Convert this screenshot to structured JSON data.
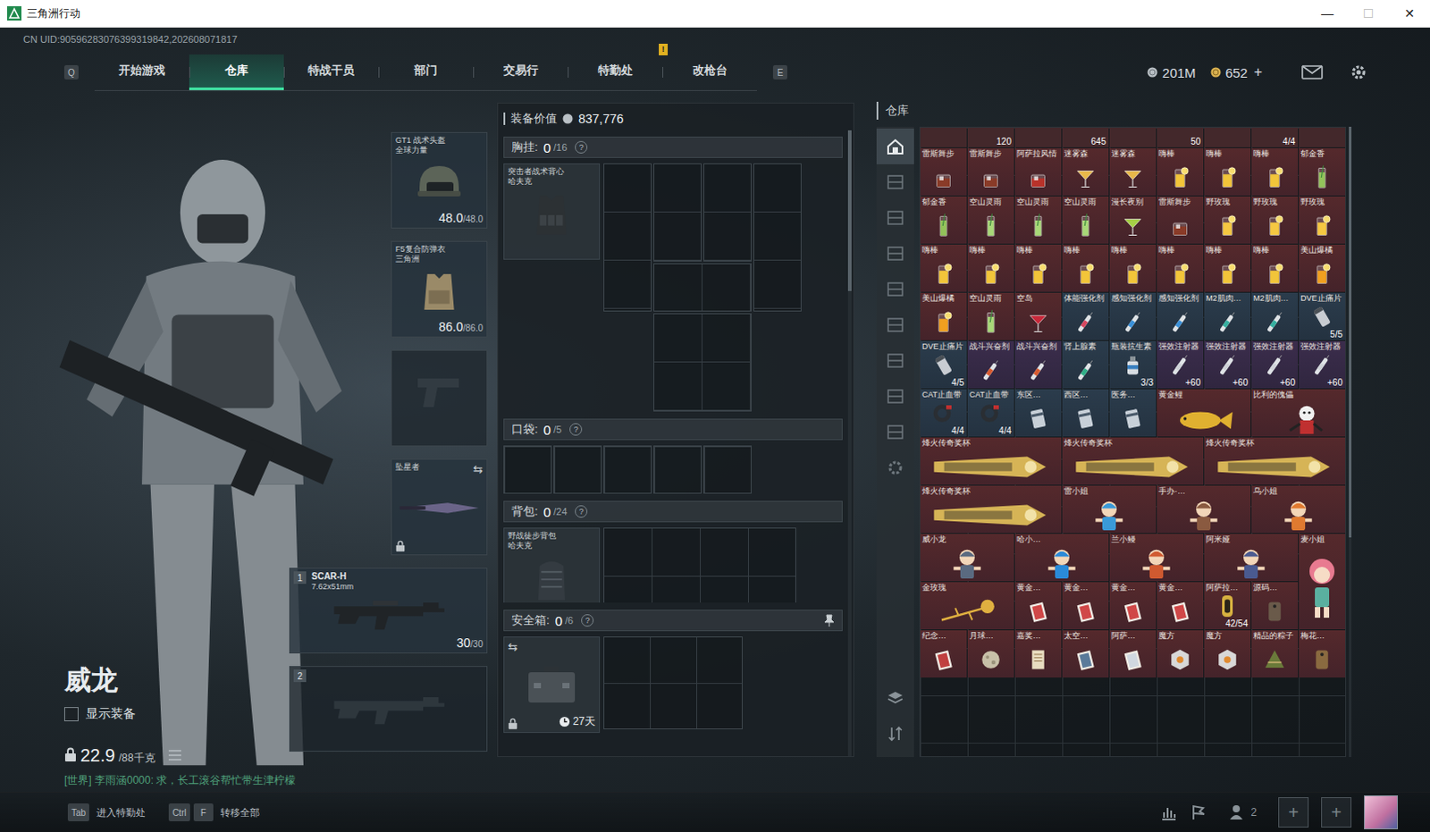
{
  "window": {
    "title": "三角洲行动",
    "controls": [
      {
        "label": "—",
        "kind": "minimize",
        "disabled": false
      },
      {
        "label": "☐",
        "kind": "maximize",
        "disabled": true
      },
      {
        "label": "✕",
        "kind": "close",
        "disabled": false
      }
    ]
  },
  "uid": "CN UID:90596283076399319842,202608071817",
  "nav": {
    "prev_key": "Q",
    "next_key": "E",
    "tabs": [
      {
        "label": "开始游戏",
        "selected": false,
        "notice": ""
      },
      {
        "label": "仓库",
        "selected": true,
        "notice": ""
      },
      {
        "label": "特战干员",
        "selected": false,
        "notice": ""
      },
      {
        "label": "部门",
        "selected": false,
        "notice": ""
      },
      {
        "label": "交易行",
        "selected": false,
        "notice": ""
      },
      {
        "label": "特勤处",
        "selected": false,
        "notice": "!"
      },
      {
        "label": "改枪台",
        "selected": false,
        "notice": ""
      }
    ]
  },
  "currency": [
    {
      "amount": "201M",
      "plus": ""
    },
    {
      "amount": "652",
      "plus": "+"
    }
  ],
  "operator": {
    "name": "威龙",
    "show_gear": {
      "label": "显示装备",
      "checked": false
    },
    "weight": "22.9",
    "weight_max": "/88千克",
    "locked": true
  },
  "chat": "[世界] 李雨涵0000: 求，长工滚谷帮忙带生津柠檬",
  "gear": [
    {
      "kind": "helmet",
      "name": "GT1 战术头盔",
      "sub": "全球力量",
      "durability": "48.0",
      "max": "/48.0",
      "empty": false,
      "locked": false,
      "swap": ""
    },
    {
      "kind": "armor",
      "name": "F5复合防弹衣",
      "sub": "三角洲",
      "durability": "86.0",
      "max": "/86.0",
      "empty": false,
      "locked": false,
      "swap": ""
    },
    {
      "kind": "pistol",
      "name": "",
      "sub": "",
      "durability": "",
      "max": "",
      "empty": true,
      "locked": false,
      "swap": ""
    },
    {
      "kind": "melee",
      "name": "坠星者",
      "sub": "",
      "durability": "",
      "max": "",
      "empty": false,
      "locked": true,
      "swap": "⇆"
    }
  ],
  "weapons": [
    {
      "index": "1",
      "name": "SCAR-H",
      "caliber": "7.62x51mm",
      "ammo": "30",
      "ammo_max": "/30",
      "empty": false
    },
    {
      "index": "2",
      "name": "",
      "caliber": "",
      "ammo": "",
      "ammo_max": "",
      "empty": true
    }
  ],
  "loadout": {
    "label": "装备价值",
    "value": "837,776",
    "sections": [
      {
        "kind": "rig",
        "title": "胸挂",
        "count": "0",
        "capacity": "/16",
        "help": "?",
        "item": {
          "name": "突击者战术背心",
          "sub": "哈夫克"
        },
        "days": "",
        "locked": false,
        "swap": "",
        "pinned": false
      },
      {
        "kind": "pockets",
        "title": "口袋",
        "count": "0",
        "capacity": "/5",
        "help": "?",
        "item": null,
        "days": "",
        "locked": false,
        "swap": "",
        "pinned": false
      },
      {
        "kind": "backpack",
        "title": "背包",
        "count": "0",
        "capacity": "/24",
        "help": "?",
        "item": {
          "name": "野战徒步背包",
          "sub": "哈夫克"
        },
        "days": "",
        "locked": false,
        "swap": "",
        "pinned": false
      },
      {
        "kind": "case",
        "title": "安全箱",
        "count": "0",
        "capacity": "/6",
        "help": "?",
        "item": null,
        "days": "27天",
        "locked": true,
        "swap": "⇆",
        "pinned": true
      }
    ]
  },
  "stash": {
    "title": "仓库",
    "side_tabs": [
      {
        "kind": "home",
        "selected": true
      },
      {
        "kind": "shelf",
        "selected": false
      },
      {
        "kind": "shelf",
        "selected": false
      },
      {
        "kind": "shelf",
        "selected": false
      },
      {
        "kind": "shelf",
        "selected": false
      },
      {
        "kind": "shelf",
        "selected": false
      },
      {
        "kind": "shelf",
        "selected": false
      },
      {
        "kind": "shelf",
        "selected": false
      },
      {
        "kind": "shelf",
        "selected": false
      },
      {
        "kind": "gear",
        "selected": false
      }
    ],
    "tools": [
      {
        "kind": "layers"
      },
      {
        "kind": "sort"
      }
    ],
    "top_row": [
      {
        "count": ""
      },
      {
        "count": "120"
      },
      {
        "count": ""
      },
      {
        "count": "645"
      },
      {
        "count": ""
      },
      {
        "count": "50"
      },
      {
        "count": ""
      },
      {
        "count": "4/4"
      },
      {
        "count": ""
      }
    ],
    "items": [
      {
        "name": "雷斯舞步",
        "kind": "tumbler",
        "color": "#8a3b28",
        "rarity": "red",
        "count": ""
      },
      {
        "name": "雷斯舞步",
        "kind": "tumbler",
        "color": "#8a3b28",
        "rarity": "red",
        "count": ""
      },
      {
        "name": "阿萨拉风情",
        "kind": "tumbler",
        "color": "#b8322a",
        "rarity": "red",
        "count": ""
      },
      {
        "name": "迷雾森",
        "kind": "coupe",
        "color": "#e8b84a",
        "rarity": "red",
        "count": ""
      },
      {
        "name": "迷雾森",
        "kind": "coupe",
        "color": "#e8b84a",
        "rarity": "red",
        "count": ""
      },
      {
        "name": "嗨棒",
        "kind": "highball",
        "color": "#f2c53a",
        "rarity": "red",
        "count": ""
      },
      {
        "name": "嗨棒",
        "kind": "highball",
        "color": "#f2c53a",
        "rarity": "red",
        "count": ""
      },
      {
        "name": "嗨棒",
        "kind": "highball",
        "color": "#f2c53a",
        "rarity": "red",
        "count": ""
      },
      {
        "name": "郁金香",
        "kind": "tall",
        "color": "#93c25a",
        "rarity": "red",
        "count": ""
      },
      {
        "name": "郁金香",
        "kind": "tall",
        "color": "#93c25a",
        "rarity": "red",
        "count": ""
      },
      {
        "name": "空山灵雨",
        "kind": "tall",
        "color": "#a8d878",
        "rarity": "red",
        "count": ""
      },
      {
        "name": "空山灵雨",
        "kind": "tall",
        "color": "#a8d878",
        "rarity": "red",
        "count": ""
      },
      {
        "name": "空山灵雨",
        "kind": "tall",
        "color": "#a8d878",
        "rarity": "red",
        "count": ""
      },
      {
        "name": "漫长夜别",
        "kind": "coupe",
        "color": "#a6d046",
        "rarity": "red",
        "count": ""
      },
      {
        "name": "雷斯舞步",
        "kind": "tumbler",
        "color": "#8a3b28",
        "rarity": "red",
        "count": ""
      },
      {
        "name": "野玫瑰",
        "kind": "highball",
        "color": "#f5c842",
        "rarity": "red",
        "count": ""
      },
      {
        "name": "野玫瑰",
        "kind": "highball",
        "color": "#f5c842",
        "rarity": "red",
        "count": ""
      },
      {
        "name": "野玫瑰",
        "kind": "highball",
        "color": "#f5c842",
        "rarity": "red",
        "count": ""
      },
      {
        "name": "嗨棒",
        "kind": "highball",
        "color": "#f2c53a",
        "rarity": "red",
        "count": ""
      },
      {
        "name": "嗨棒",
        "kind": "highball",
        "color": "#f2c53a",
        "rarity": "red",
        "count": ""
      },
      {
        "name": "嗨棒",
        "kind": "highball",
        "color": "#f2c53a",
        "rarity": "red",
        "count": ""
      },
      {
        "name": "嗨棒",
        "kind": "highball",
        "color": "#f2c53a",
        "rarity": "red",
        "count": ""
      },
      {
        "name": "嗨棒",
        "kind": "highball",
        "color": "#f2c53a",
        "rarity": "red",
        "count": ""
      },
      {
        "name": "嗨棒",
        "kind": "highball",
        "color": "#f2c53a",
        "rarity": "red",
        "count": ""
      },
      {
        "name": "嗨棒",
        "kind": "highball",
        "color": "#f2c53a",
        "rarity": "red",
        "count": ""
      },
      {
        "name": "嗨棒",
        "kind": "highball",
        "color": "#f2c53a",
        "rarity": "red",
        "count": ""
      },
      {
        "name": "美山爆橘",
        "kind": "highball",
        "color": "#f0a020",
        "rarity": "red",
        "count": ""
      },
      {
        "name": "美山爆橘",
        "kind": "highball",
        "color": "#f0a020",
        "rarity": "red",
        "count": ""
      },
      {
        "name": "空山灵雨",
        "kind": "tall",
        "color": "#a8d878",
        "rarity": "red",
        "count": ""
      },
      {
        "name": "空岛",
        "kind": "coupe",
        "color": "#c8283a",
        "rarity": "red",
        "count": ""
      },
      {
        "name": "体能强化剂",
        "kind": "injector",
        "color": "#d84860",
        "rarity": "blue",
        "count": ""
      },
      {
        "name": "感知强化剂",
        "kind": "injector",
        "color": "#3a90d8",
        "rarity": "blue",
        "count": ""
      },
      {
        "name": "感知强化剂",
        "kind": "injector",
        "color": "#3a90d8",
        "rarity": "blue",
        "count": ""
      },
      {
        "name": "M2肌肉…",
        "kind": "injector",
        "color": "#36b0a0",
        "rarity": "blue",
        "count": ""
      },
      {
        "name": "M2肌肉…",
        "kind": "injector",
        "color": "#36b0a0",
        "rarity": "blue",
        "count": ""
      },
      {
        "name": "DVE止痛片",
        "kind": "pill",
        "color": "#c8ccd2",
        "rarity": "blue",
        "count": "5/5"
      },
      {
        "name": "DVE止痛片",
        "kind": "pill",
        "color": "#c8ccd2",
        "rarity": "blue",
        "count": "4/5"
      },
      {
        "name": "战斗兴奋剂",
        "kind": "injector",
        "color": "#d85a30",
        "rarity": "purple",
        "count": ""
      },
      {
        "name": "战斗兴奋剂",
        "kind": "injector",
        "color": "#d85a30",
        "rarity": "purple",
        "count": ""
      },
      {
        "name": "肾上腺素",
        "kind": "injector",
        "color": "#30b088",
        "rarity": "blue",
        "count": ""
      },
      {
        "name": "瓶装抗生素",
        "kind": "bottle",
        "color": "#d8dde2",
        "rarity": "blue",
        "count": "3/3"
      },
      {
        "name": "强效注射器",
        "kind": "injector",
        "color": "#cfd3d8",
        "rarity": "purple",
        "count": "+60"
      },
      {
        "name": "强效注射器",
        "kind": "injector",
        "color": "#cfd3d8",
        "rarity": "purple",
        "count": "+60"
      },
      {
        "name": "强效注射器",
        "kind": "injector",
        "color": "#cfd3d8",
        "rarity": "purple",
        "count": "+60"
      },
      {
        "name": "强效注射器",
        "kind": "injector",
        "color": "#cfd3d8",
        "rarity": "purple",
        "count": "+60"
      },
      {
        "name": "CAT止血带",
        "kind": "tourniquet",
        "color": "#2a2e33",
        "rarity": "blue",
        "count": "4/4"
      },
      {
        "name": "CAT止血带",
        "kind": "tourniquet",
        "color": "#2a2e33",
        "rarity": "blue",
        "count": "4/4"
      },
      {
        "name": "东区…",
        "kind": "keycard",
        "color": "#c8d0d8",
        "rarity": "blue",
        "count": ""
      },
      {
        "name": "西区…",
        "kind": "keycard",
        "color": "#c8d0d8",
        "rarity": "blue",
        "count": ""
      },
      {
        "name": "医务…",
        "kind": "keycard",
        "color": "#c8d0d8",
        "rarity": "blue",
        "count": ""
      },
      {
        "name": "黄金鲤",
        "kind": "fish",
        "color": "#e0b030",
        "rarity": "red",
        "count": ""
      },
      {
        "name": "比利的傀儡",
        "kind": "doll",
        "color": "#c03030",
        "rarity": "red",
        "count": ""
      },
      {
        "name": "烽火传奇奖杯",
        "kind": "trophy",
        "color": "#d6b456",
        "rarity": "red",
        "count": ""
      },
      {
        "name": "烽火传奇奖杯",
        "kind": "trophy",
        "color": "#d6b456",
        "rarity": "red",
        "count": ""
      },
      {
        "name": "烽火传奇奖杯",
        "kind": "trophy",
        "color": "#d6b456",
        "rarity": "red",
        "count": ""
      },
      {
        "name": "烽火传奇奖杯",
        "kind": "trophy",
        "color": "#d6b456",
        "rarity": "red",
        "count": ""
      },
      {
        "name": "雷小姐",
        "kind": "figure",
        "color": "#3a9ad8",
        "rarity": "red",
        "count": ""
      },
      {
        "name": "手办·…",
        "kind": "figure",
        "color": "#8a5a40",
        "rarity": "red",
        "count": ""
      },
      {
        "name": "乌小姐",
        "kind": "figure",
        "color": "#e07a30",
        "rarity": "red",
        "count": ""
      },
      {
        "name": "威小龙",
        "kind": "figure",
        "color": "#5a6a80",
        "rarity": "red",
        "count": ""
      },
      {
        "name": "哈小…",
        "kind": "figure",
        "color": "#2a8ad8",
        "rarity": "red",
        "count": ""
      },
      {
        "name": "兰小鳗",
        "kind": "figure",
        "color": "#d05a30",
        "rarity": "red",
        "count": ""
      },
      {
        "name": "阿米娅",
        "kind": "figure",
        "color": "#4a5a90",
        "rarity": "red",
        "count": ""
      },
      {
        "name": "麦小姐",
        "kind": "chibi",
        "color": "#e87a90",
        "rarity": "red",
        "count": ""
      },
      {
        "name": "金玫瑰",
        "kind": "flower",
        "color": "#e0b040",
        "rarity": "red",
        "count": ""
      },
      {
        "name": "黄金…",
        "kind": "card",
        "color": "#d04848",
        "rarity": "red",
        "count": ""
      },
      {
        "name": "黄金…",
        "kind": "card",
        "color": "#d04848",
        "rarity": "red",
        "count": ""
      },
      {
        "name": "黄金…",
        "kind": "card",
        "color": "#d04848",
        "rarity": "red",
        "count": ""
      },
      {
        "name": "黄金…",
        "kind": "card",
        "color": "#d04848",
        "rarity": "red",
        "count": ""
      },
      {
        "name": "阿萨拉…",
        "kind": "badge",
        "color": "#d6b040",
        "rarity": "red",
        "count": "42/54"
      },
      {
        "name": "源码…",
        "kind": "tag",
        "color": "#6a5a4a",
        "rarity": "red",
        "count": ""
      },
      {
        "name": "纪念…",
        "kind": "card",
        "color": "#c04040",
        "rarity": "red",
        "count": ""
      },
      {
        "name": "月球…",
        "kind": "orb",
        "color": "#c8c0a8",
        "rarity": "red",
        "count": ""
      },
      {
        "name": "嘉奖…",
        "kind": "scroll",
        "color": "#e8dcc0",
        "rarity": "red",
        "count": ""
      },
      {
        "name": "太空…",
        "kind": "card",
        "color": "#5a7a9a",
        "rarity": "red",
        "count": ""
      },
      {
        "name": "阿萨…",
        "kind": "card",
        "color": "#d0d8e0",
        "rarity": "red",
        "count": ""
      },
      {
        "name": "魔方",
        "kind": "cube",
        "color": "#d8d8d8",
        "rarity": "red",
        "count": ""
      },
      {
        "name": "魔方",
        "kind": "cube",
        "color": "#d8d8d8",
        "rarity": "red",
        "count": ""
      },
      {
        "name": "精品的粽子",
        "kind": "zongzi",
        "color": "#6a7a3a",
        "rarity": "red",
        "count": ""
      },
      {
        "name": "梅花…",
        "kind": "tag",
        "color": "#8a6a40",
        "rarity": "red",
        "count": ""
      }
    ]
  },
  "bottom_bar": {
    "hints": [
      {
        "keys": [
          "Tab"
        ],
        "label": "进入特勤处"
      },
      {
        "keys": [
          "Ctrl",
          "F"
        ],
        "label": "转移全部"
      }
    ],
    "team_count": "2",
    "slots": [
      "+",
      "+"
    ]
  }
}
